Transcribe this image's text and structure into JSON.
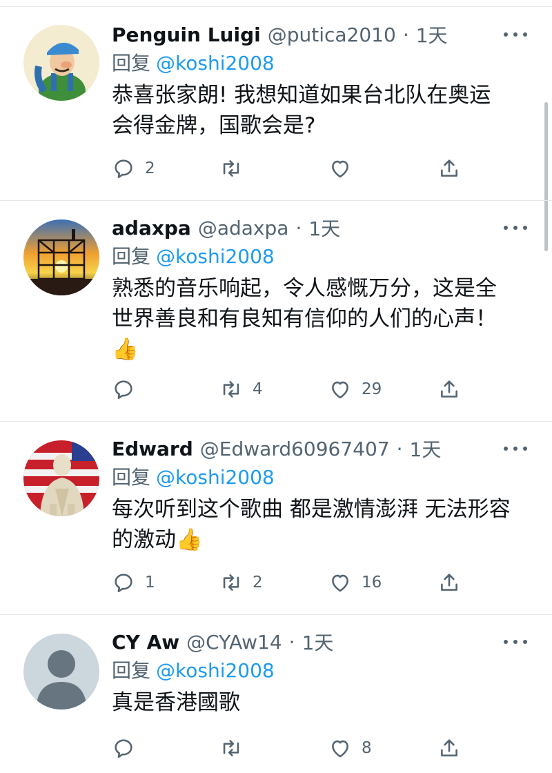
{
  "reply_prefix": "回复",
  "tweets": [
    {
      "name": "Penguin Luigi",
      "handle": "@putica2010",
      "time": "1天",
      "reply_to": "@koshi2008",
      "text": "恭喜张家朗! 我想知道如果台北队在奥运\n会得金牌，国歌会是?",
      "reply_count": "2",
      "retweet_count": "",
      "like_count": "",
      "avatar": "cartoon-plumber-avatar"
    },
    {
      "name": "adaxpa",
      "handle": "@adaxpa",
      "time": "1天",
      "reply_to": "@koshi2008",
      "text": "熟悉的音乐响起，令人感慨万分，这是全\n世界善良和有良知有信仰的人们的心声！\n👍",
      "reply_count": "",
      "retweet_count": "4",
      "like_count": "29",
      "avatar": "sunset-scaffold-avatar"
    },
    {
      "name": "Edward",
      "handle": "@Edward60967407",
      "time": "1天",
      "reply_to": "@koshi2008",
      "text": "每次听到这个歌曲 都是激情澎湃 无法形容\n的激动👍",
      "reply_count": "1",
      "retweet_count": "2",
      "like_count": "16",
      "avatar": "statue-flag-avatar"
    },
    {
      "name": "CY Aw",
      "handle": "@CYAw14",
      "time": "1天",
      "reply_to": "@koshi2008",
      "text": "真是香港國歌",
      "reply_count": "",
      "retweet_count": "",
      "like_count": "8",
      "avatar": "default-profile-avatar"
    }
  ],
  "colors": {
    "text": "#0f1419",
    "secondary": "#536471",
    "link": "#1d9bf0",
    "divider": "#e6e9ec"
  },
  "icons": [
    "reply-icon",
    "retweet-icon",
    "like-icon",
    "share-icon",
    "more-icon"
  ]
}
